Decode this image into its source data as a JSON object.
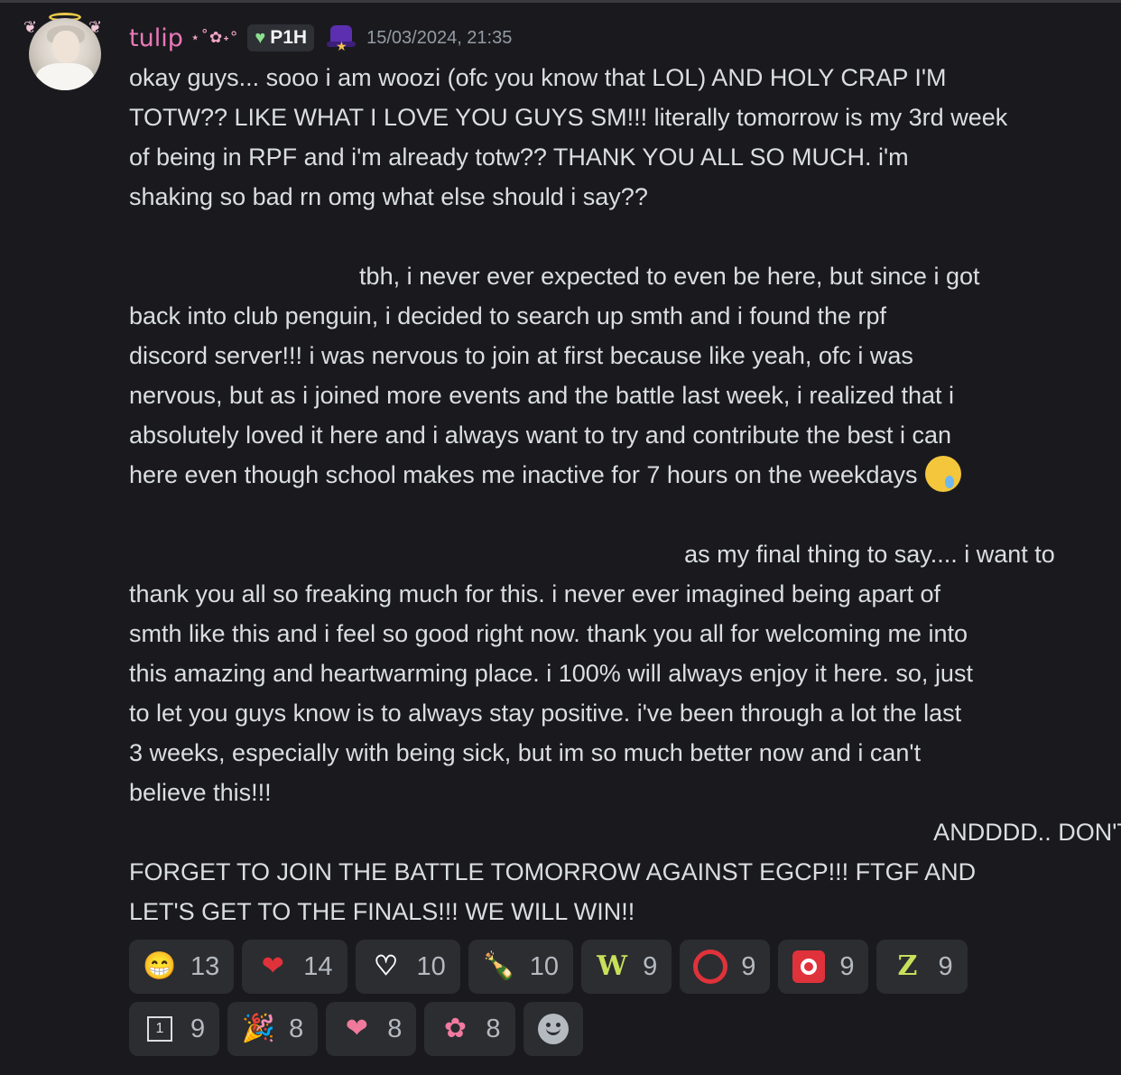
{
  "user": {
    "username": "tulip",
    "name_decoration": "⋆˚✿˖°",
    "tag": "P1H",
    "timestamp": "15/03/2024, 21:35"
  },
  "message": {
    "lines": [
      "okay guys... sooo i am woozi (ofc you know that LOL) AND HOLY CRAP I'M",
      "TOTW?? LIKE WHAT I LOVE YOU GUYS SM!!! literally tomorrow is my 3rd week",
      "of being in RPF and i'm already totw?? THANK YOU ALL SO MUCH. i'm",
      "shaking so bad rn omg what else should i say??",
      "",
      "                                  tbh, i never ever expected to even be here, but since i got",
      "back into club penguin, i decided to search up smth and i found the rpf",
      "discord server!!! i was nervous to join at first because like yeah, ofc i was",
      "nervous, but as i joined more events and the battle last week, i realized that i",
      "absolutely loved it here and i always want to try and contribute the best i can",
      "here even though school makes me inactive for 7 hours on the weekdays",
      "",
      "                                                                                  as my final thing to say.... i want to",
      "thank you all so freaking much for this. i never ever imagined being apart of",
      "smth like this and i feel so good right now. thank you all for welcoming me into",
      "this amazing and heartwarming place. i 100% will always enjoy it here. so, just",
      "to let you guys know is to always stay positive. i've been through a lot the last",
      "3 weeks, especially with being sick, but im so much better now and i can't",
      "believe this!!!",
      "                                                                                                                       ANDDDD.. DON'T",
      "FORGET TO JOIN THE BATTLE TOMORROW AGAINST EGCP!!! FTGF AND",
      "LET'S GET TO THE FINALS!!! WE WILL WIN!!"
    ]
  },
  "reactions": [
    {
      "icon": "grinning-face-icon",
      "glyph": "😁",
      "count": "13"
    },
    {
      "icon": "red-heart-icon",
      "glyph": "❤",
      "count": "14"
    },
    {
      "icon": "white-heart-icon",
      "glyph": "♡",
      "count": "10"
    },
    {
      "icon": "bottle-icon",
      "glyph": "🍾",
      "count": "10"
    },
    {
      "icon": "w-letter-icon",
      "glyph": "W",
      "count": "9"
    },
    {
      "icon": "red-circle-icon",
      "glyph": "",
      "count": "9"
    },
    {
      "icon": "o-button-icon",
      "glyph": "",
      "count": "9"
    },
    {
      "icon": "z-letter-icon",
      "glyph": "Z",
      "count": "9"
    },
    {
      "icon": "one-box-icon",
      "glyph": "1",
      "count": "9"
    },
    {
      "icon": "party-popper-icon",
      "glyph": "🎉",
      "count": "8"
    },
    {
      "icon": "pink-heart-icon",
      "glyph": "❤",
      "count": "8"
    },
    {
      "icon": "lotus-icon",
      "glyph": "✿",
      "count": "8"
    }
  ]
}
